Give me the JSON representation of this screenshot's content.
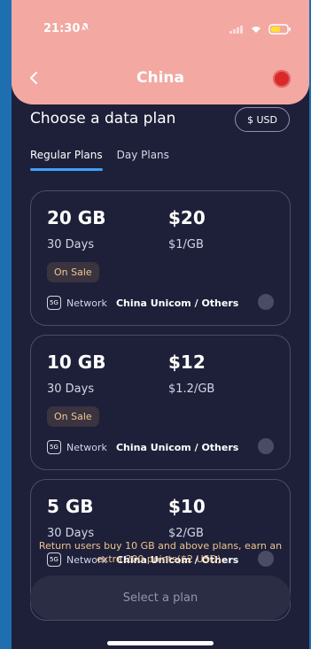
{
  "status": {
    "time": "21:30"
  },
  "header": {
    "title": "China"
  },
  "plan_section": {
    "title": "Choose a data plan",
    "currency": "$ USD"
  },
  "tabs": [
    {
      "label": "Regular Plans"
    },
    {
      "label": "Day Plans"
    }
  ],
  "plans": [
    {
      "size": "20 GB",
      "price": "$20",
      "days": "30 Days",
      "per": "$1/GB",
      "badge": "On Sale",
      "network_label": "Network",
      "carrier": "China Unicom / Others"
    },
    {
      "size": "10 GB",
      "price": "$12",
      "days": "30 Days",
      "per": "$1.2/GB",
      "badge": "On Sale",
      "network_label": "Network",
      "carrier": "China Unicom / Others"
    },
    {
      "size": "5 GB",
      "price": "$10",
      "days": "30 Days",
      "per": "$2/GB",
      "network_label": "Network",
      "carrier": "China Unicom / Others"
    }
  ],
  "promo": "Return users buy 10 GB and above plans, earn an extra 200 points($2 USD).",
  "footer": {
    "select_label": "Select a plan"
  }
}
